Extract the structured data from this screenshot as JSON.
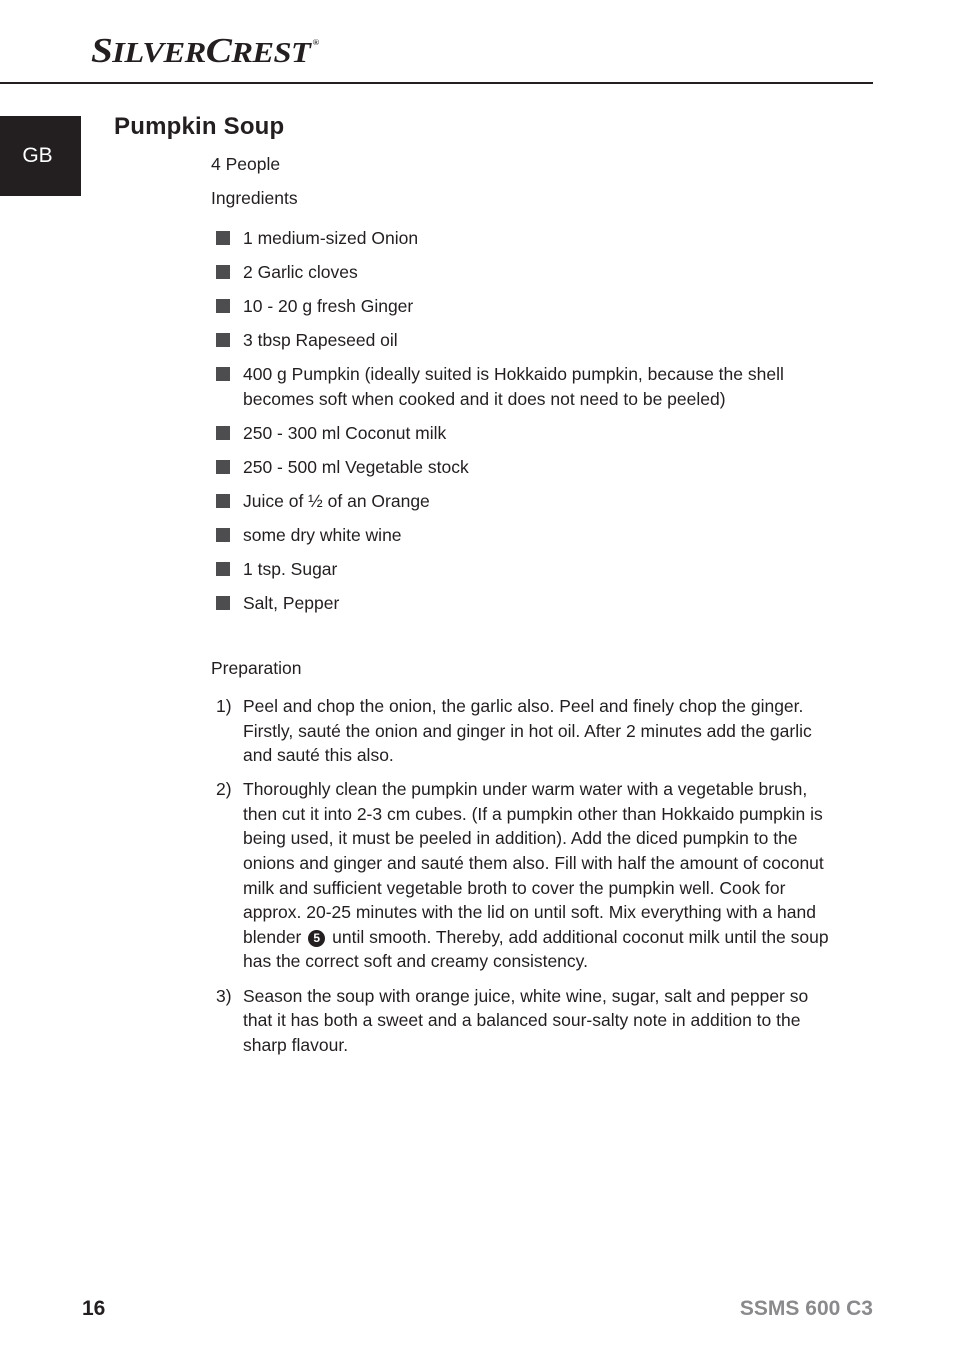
{
  "header": {
    "brand_first": "S",
    "brand_mid1": "ILVER",
    "brand_first2": "C",
    "brand_mid2": "REST",
    "brand_registered": "®",
    "language_tab": "GB"
  },
  "title": "Pumpkin Soup",
  "servings": "4 People",
  "ingredients": {
    "heading": "Ingredients",
    "items": [
      "1 medium-sized Onion",
      "2 Garlic cloves",
      "10 - 20 g fresh Ginger",
      "3 tbsp Rapeseed oil",
      "400 g Pumpkin (ideally suited is Hokkaido pumpkin, because the shell becomes soft when cooked and it does not need to be peeled)",
      "250 - 300 ml Coconut milk",
      "250 - 500 ml Vegetable stock",
      "Juice of ½ of an Orange",
      "some dry white wine",
      "1 tsp. Sugar",
      "Salt, Pepper"
    ]
  },
  "preparation": {
    "heading": "Preparation",
    "steps": [
      {
        "num": "1)",
        "text": "Peel and chop the onion, the garlic also. Peel and finely chop the ginger. Firstly, sauté the onion and ginger in hot oil. After 2 minutes add the garlic and sauté this also."
      },
      {
        "num": "2)",
        "text_before": "Thoroughly clean the pumpkin under warm water with a vegetable brush, then cut it into 2-3 cm cubes. (If a pumpkin other than Hokkaido pumpkin is being used, it must be peeled in addition). Add the diced pumpkin to the onions and ginger and sauté them also. Fill with half the amount of coconut milk and sufficient vegetable broth to cover the pumpkin well. Cook for approx. 20-25 minutes with the lid on until soft. Mix everything with a hand blender",
        "ref_number": "5",
        "text_after": "until smooth. Thereby, add additional coconut milk until the soup has the correct soft and creamy consistency."
      },
      {
        "num": "3)",
        "text": "Season the soup with orange juice, white wine, sugar, salt and pepper so that it has both a sweet and a balanced sour-salty note in addition to the sharp flavour."
      }
    ]
  },
  "footer": {
    "page_number": "16",
    "model": "SSMS 600 C3"
  },
  "colors": {
    "text": "#231f20",
    "bullet": "#4d4d4f",
    "model_gray": "#8a8a8c"
  }
}
